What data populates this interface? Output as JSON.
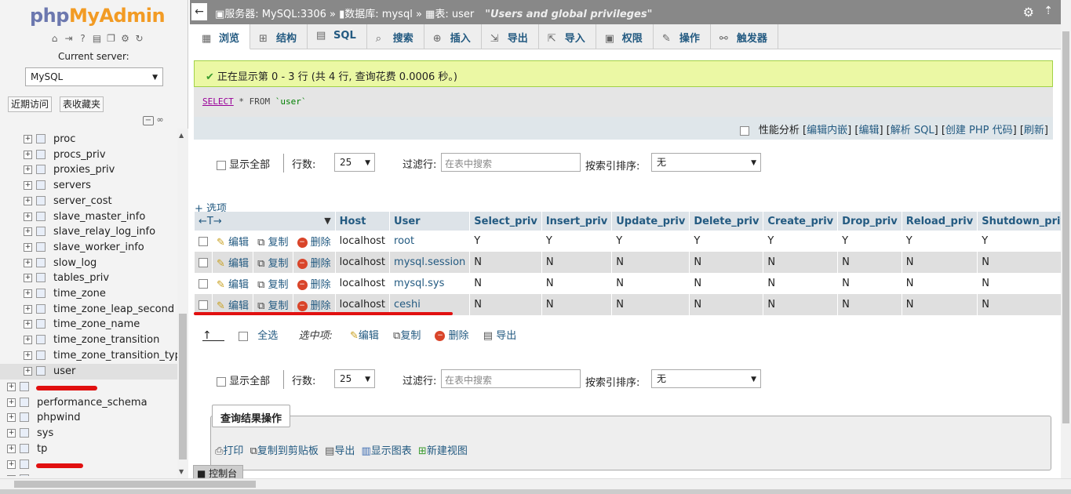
{
  "left": {
    "logo": {
      "part1": "php",
      "part2": "MyAdmin"
    },
    "current_server_label": "Current server:",
    "server_value": "MySQL",
    "tabs": [
      "近期访问",
      "表收藏夹"
    ],
    "tables": [
      "proc",
      "procs_priv",
      "proxies_priv",
      "servers",
      "server_cost",
      "slave_master_info",
      "slave_relay_log_info",
      "slave_worker_info",
      "slow_log",
      "tables_priv",
      "time_zone",
      "time_zone_leap_second",
      "time_zone_name",
      "time_zone_transition",
      "time_zone_transition_typ",
      "user"
    ],
    "databases": [
      "",
      "performance_schema",
      "phpwind",
      "sys",
      "tp",
      "",
      ""
    ]
  },
  "topbar": {
    "server": "服务器: MySQL:3306",
    "database": "数据库: mysql",
    "table": "表: user",
    "comment": "\"Users and global privileges\""
  },
  "tabs": [
    {
      "label": "浏览",
      "icon": "browse-icon"
    },
    {
      "label": "结构",
      "icon": "structure-icon"
    },
    {
      "label": "SQL",
      "icon": "sql-icon"
    },
    {
      "label": "搜索",
      "icon": "search-icon"
    },
    {
      "label": "插入",
      "icon": "insert-icon"
    },
    {
      "label": "导出",
      "icon": "export-icon"
    },
    {
      "label": "导入",
      "icon": "import-icon"
    },
    {
      "label": "权限",
      "icon": "privileges-icon"
    },
    {
      "label": "操作",
      "icon": "operations-icon"
    },
    {
      "label": "触发器",
      "icon": "triggers-icon"
    }
  ],
  "message": "正在显示第 0 - 3 行 (共 4 行, 查询花费 0.0006 秒。)",
  "sql": {
    "select": "SELECT",
    "rest": " * FROM ",
    "table": "`user`"
  },
  "profiling": {
    "label": "性能分析",
    "links": [
      "编辑内嵌",
      "编辑",
      "解析 SQL",
      "创建 PHP 代码",
      "刷新"
    ]
  },
  "nav": {
    "show_all": "显示全部",
    "rows_label": "行数:",
    "rows_value": "25",
    "filter_label": "过滤行:",
    "filter_placeholder": "在表中搜索",
    "sort_label": "按索引排序:",
    "sort_value": "无"
  },
  "options_label": "+ 选项",
  "table": {
    "columns": [
      "Host",
      "User",
      "Select_priv",
      "Insert_priv",
      "Update_priv",
      "Delete_priv",
      "Create_priv",
      "Drop_priv",
      "Reload_priv",
      "Shutdown_priv"
    ],
    "actions": {
      "edit": "编辑",
      "copy": "复制",
      "delete": "删除"
    },
    "rows": [
      [
        "localhost",
        "root",
        "Y",
        "Y",
        "Y",
        "Y",
        "Y",
        "Y",
        "Y",
        "Y"
      ],
      [
        "localhost",
        "mysql.session",
        "N",
        "N",
        "N",
        "N",
        "N",
        "N",
        "N",
        "N"
      ],
      [
        "localhost",
        "mysql.sys",
        "N",
        "N",
        "N",
        "N",
        "N",
        "N",
        "N",
        "N"
      ],
      [
        "localhost",
        "ceshi",
        "N",
        "N",
        "N",
        "N",
        "N",
        "N",
        "N",
        "N"
      ]
    ]
  },
  "with_selected": {
    "check_all": "全选",
    "label": "选中项:",
    "edit": "编辑",
    "copy": "复制",
    "delete": "删除",
    "export": "导出"
  },
  "query_ops": {
    "title": "查询结果操作",
    "print": "打印",
    "copy_clipboard": "复制到剪贴板",
    "export": "导出",
    "chart": "显示图表",
    "create_view": "新建视图"
  },
  "console": "控制台",
  "colors": {
    "link": "#235a81",
    "success_bg": "#ebf8a4",
    "header_bg": "#dde3e8"
  }
}
